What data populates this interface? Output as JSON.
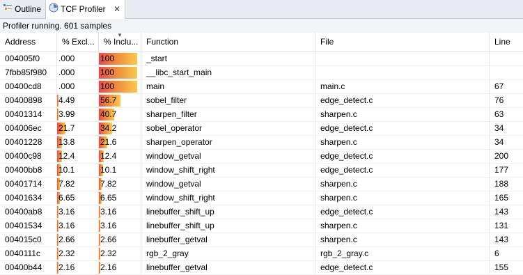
{
  "tabs": {
    "outline": "Outline",
    "profiler": "TCF Profiler",
    "profiler_close": "✕"
  },
  "status": "Profiler running. 601 samples",
  "columns": {
    "address": "Address",
    "excl": "% Excl...",
    "incl": "% Inclu...",
    "function": "Function",
    "file": "File",
    "line": "Line"
  },
  "rows": [
    {
      "address": "004005f0",
      "excl": ".000",
      "excl_pct": 0,
      "incl": "100",
      "incl_pct": 100,
      "function": "_start",
      "file": "",
      "line": ""
    },
    {
      "address": "7fbb85f980",
      "excl": ".000",
      "excl_pct": 0,
      "incl": "100",
      "incl_pct": 100,
      "function": "__libc_start_main",
      "file": "",
      "line": ""
    },
    {
      "address": "00400cd8",
      "excl": ".000",
      "excl_pct": 0,
      "incl": "100",
      "incl_pct": 100,
      "function": "main",
      "file": "main.c",
      "line": "67"
    },
    {
      "address": "00400898",
      "excl": "4.49",
      "excl_pct": 4.49,
      "incl": "56.7",
      "incl_pct": 56.7,
      "function": "sobel_filter",
      "file": "edge_detect.c",
      "line": "76"
    },
    {
      "address": "00401314",
      "excl": "3.99",
      "excl_pct": 3.99,
      "incl": "40.7",
      "incl_pct": 40.7,
      "function": "sharpen_filter",
      "file": "sharpen.c",
      "line": "63"
    },
    {
      "address": "004006ec",
      "excl": "21.7",
      "excl_pct": 21.7,
      "incl": "34.2",
      "incl_pct": 34.2,
      "function": "sobel_operator",
      "file": "edge_detect.c",
      "line": "34"
    },
    {
      "address": "00401228",
      "excl": "13.8",
      "excl_pct": 13.8,
      "incl": "21.6",
      "incl_pct": 21.6,
      "function": "sharpen_operator",
      "file": "sharpen.c",
      "line": "34"
    },
    {
      "address": "00400c98",
      "excl": "12.4",
      "excl_pct": 12.4,
      "incl": "12.4",
      "incl_pct": 12.4,
      "function": "window_getval",
      "file": "edge_detect.c",
      "line": "200"
    },
    {
      "address": "00400bb8",
      "excl": "10.1",
      "excl_pct": 10.1,
      "incl": "10.1",
      "incl_pct": 10.1,
      "function": "window_shift_right",
      "file": "edge_detect.c",
      "line": "177"
    },
    {
      "address": "00401714",
      "excl": "7.82",
      "excl_pct": 7.82,
      "incl": "7.82",
      "incl_pct": 7.82,
      "function": "window_getval",
      "file": "sharpen.c",
      "line": "188"
    },
    {
      "address": "00401634",
      "excl": "6.65",
      "excl_pct": 6.65,
      "incl": "6.65",
      "incl_pct": 6.65,
      "function": "window_shift_right",
      "file": "sharpen.c",
      "line": "165"
    },
    {
      "address": "00400ab8",
      "excl": "3.16",
      "excl_pct": 3.16,
      "incl": "3.16",
      "incl_pct": 3.16,
      "function": "linebuffer_shift_up",
      "file": "edge_detect.c",
      "line": "143"
    },
    {
      "address": "00401534",
      "excl": "3.16",
      "excl_pct": 3.16,
      "incl": "3.16",
      "incl_pct": 3.16,
      "function": "linebuffer_shift_up",
      "file": "sharpen.c",
      "line": "131"
    },
    {
      "address": "004015c0",
      "excl": "2.66",
      "excl_pct": 2.66,
      "incl": "2.66",
      "incl_pct": 2.66,
      "function": "linebuffer_getval",
      "file": "sharpen.c",
      "line": "143"
    },
    {
      "address": "0040111c",
      "excl": "2.32",
      "excl_pct": 2.32,
      "incl": "2.32",
      "incl_pct": 2.32,
      "function": "rgb_2_gray",
      "file": "rgb_2_gray.c",
      "line": "6"
    },
    {
      "address": "00400b44",
      "excl": "2.16",
      "excl_pct": 2.16,
      "incl": "2.16",
      "incl_pct": 2.16,
      "function": "linebuffer_getval",
      "file": "edge_detect.c",
      "line": "155"
    }
  ],
  "icons": {
    "outline": "outline-icon",
    "profiler": "profiler-icon",
    "sort": "sort-descending-icon"
  }
}
